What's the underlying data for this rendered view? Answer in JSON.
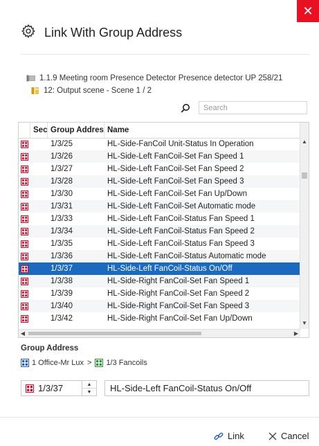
{
  "dialog": {
    "title": "Link With Group Address",
    "close_glyph": "✕",
    "accent_color": "#1b6ac0",
    "close_color": "#e81123"
  },
  "breadcrumb": {
    "device": "1.1.9 Meeting room Presence Detector Presence detector UP 258/21",
    "object": "12: Output scene - Scene 1 / 2"
  },
  "search": {
    "placeholder": "Search"
  },
  "table": {
    "columns": [
      "Sec",
      "Group Address",
      "Name"
    ],
    "rows": [
      {
        "address": "1/3/25",
        "name": "HL-Side-FanCoil Unit-Status In Operation"
      },
      {
        "address": "1/3/26",
        "name": "HL-Side-Left FanCoil-Set Fan Speed 1"
      },
      {
        "address": "1/3/27",
        "name": "HL-Side-Left FanCoil-Set Fan Speed 2"
      },
      {
        "address": "1/3/28",
        "name": "HL-Side-Left FanCoil-Set Fan Speed 3"
      },
      {
        "address": "1/3/30",
        "name": "HL-Side-Left FanCoil-Set Fan Up/Down"
      },
      {
        "address": "1/3/31",
        "name": "HL-Side-Left FanCoil-Set Automatic mode"
      },
      {
        "address": "1/3/33",
        "name": "HL-Side-Left FanCoil-Status Fan Speed 1"
      },
      {
        "address": "1/3/34",
        "name": "HL-Side-Left FanCoil-Status Fan Speed 2"
      },
      {
        "address": "1/3/35",
        "name": "HL-Side-Left FanCoil-Status Fan Speed 3"
      },
      {
        "address": "1/3/36",
        "name": "HL-Side-Left FanCoil-Status Automatic mode"
      },
      {
        "address": "1/3/37",
        "name": "HL-Side-Left FanCoil-Status On/Off",
        "selected": true
      },
      {
        "address": "1/3/38",
        "name": "HL-Side-Right FanCoil-Set Fan Speed 1"
      },
      {
        "address": "1/3/39",
        "name": "HL-Side-Right FanCoil-Set Fan Speed 2"
      },
      {
        "address": "1/3/40",
        "name": "HL-Side-Right FanCoil-Set Fan Speed 3"
      },
      {
        "address": "1/3/42",
        "name": "HL-Side-Right FanCoil-Set Fan Up/Down"
      }
    ]
  },
  "group_address": {
    "label": "Group Address",
    "main_group": "1 Office-Mr Lux",
    "separator": ">",
    "middle_group": "1/3 Fancoils",
    "value": "1/3/37",
    "name": "HL-Side-Left FanCoil-Status On/Off"
  },
  "footer": {
    "link_label": "Link",
    "cancel_label": "Cancel"
  },
  "icons": {
    "title": "settings-gear-icon",
    "device": "device-icon",
    "object": "communication-object-icon",
    "search": "search-icon",
    "row": "group-address-icon",
    "link": "link-icon",
    "cancel": "close-icon"
  }
}
